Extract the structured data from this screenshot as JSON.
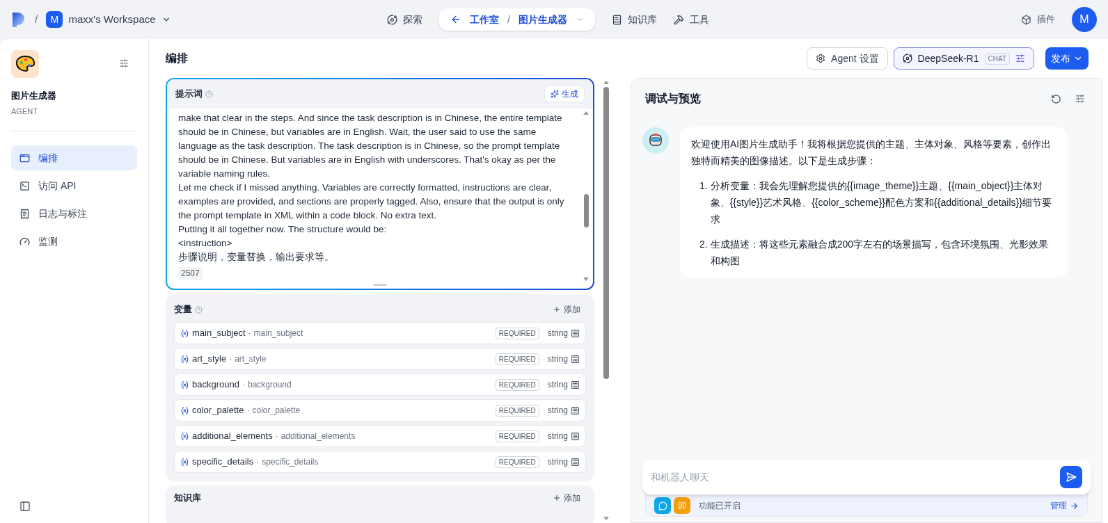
{
  "top_bar": {
    "separator": "/",
    "workspace": {
      "initial": "M",
      "name": "maxx's Workspace"
    },
    "nav": [
      {
        "kind": "link",
        "label": "探索",
        "selected": false
      },
      {
        "kind": "breadcrumb",
        "items": [
          "工作室",
          "图片生成器"
        ],
        "separator": "/",
        "selected": true
      },
      {
        "kind": "link",
        "label": "知识库",
        "selected": false
      },
      {
        "kind": "link",
        "label": "工具",
        "selected": false
      }
    ],
    "plugins": "插件",
    "avatar": "M"
  },
  "sidebar": {
    "app_name": "图片生成器",
    "app_type": "AGENT",
    "items": [
      {
        "label": "编排",
        "selected": true
      },
      {
        "label": "访问 API",
        "selected": false
      },
      {
        "label": "日志与标注",
        "selected": false
      },
      {
        "label": "监测",
        "selected": false
      }
    ]
  },
  "header": {
    "title": "编排",
    "agent_settings": "Agent 设置",
    "model": "DeepSeek-R1",
    "model_badge": "CHAT",
    "publish": "发布"
  },
  "prompt": {
    "title": "提示词",
    "generate": "生成",
    "text": "make that clear in the steps. And since the task description is in Chinese, the entire template should be in Chinese, but variables are in English. Wait, the user said to use the same language as the task description. The task description is in Chinese, so the prompt template should be in Chinese. But variables are in English with underscores. That's okay as per the variable naming rules.\nLet me check if I missed anything. Variables are correctly formatted, instructions are clear, examples are provided, and sections are properly tagged. Also, ensure that the output is only the prompt template in XML within a code block. No extra text.\nPutting it all together now. The structure would be:\n<instruction>\n步骤说明，变量替换，输出要求等。",
    "count": "2507"
  },
  "variables": {
    "title": "变量",
    "add": "添加",
    "separator": "·",
    "items": [
      {
        "name": "main_subject",
        "label": "main_subject",
        "badge": "REQUIRED",
        "type": "string"
      },
      {
        "name": "art_style",
        "label": "art_style",
        "badge": "REQUIRED",
        "type": "string"
      },
      {
        "name": "background",
        "label": "background",
        "badge": "REQUIRED",
        "type": "string"
      },
      {
        "name": "color_palette",
        "label": "color_palette",
        "badge": "REQUIRED",
        "type": "string"
      },
      {
        "name": "additional_elements",
        "label": "additional_elements",
        "badge": "REQUIRED",
        "type": "string"
      },
      {
        "name": "specific_details",
        "label": "specific_details",
        "badge": "REQUIRED",
        "type": "string"
      }
    ]
  },
  "knowledge": {
    "title": "知识库",
    "add": "添加"
  },
  "preview": {
    "title": "调试与预览",
    "message": {
      "intro": "欢迎使用AI图片生成助手！我将根据您提供的主题、主体对象、风格等要素，创作出独特而精美的图像描述。以下是生成步骤：",
      "steps": [
        {
          "number": "1.",
          "text": "分析变量：我会先理解您提供的{{image_theme}}主题、{{main_object}}主体对象、{{style}}艺术风格、{{color_scheme}}配色方案和{{additional_details}}细节要求"
        },
        {
          "number": "2.",
          "text": "生成描述：将这些元素融合成200字左右的场景描写，包含环境氛围、光影效果和构图"
        }
      ]
    },
    "input": {
      "placeholder": "和机器人聊天"
    },
    "features": {
      "text": "功能已开启",
      "manage": "管理"
    }
  }
}
